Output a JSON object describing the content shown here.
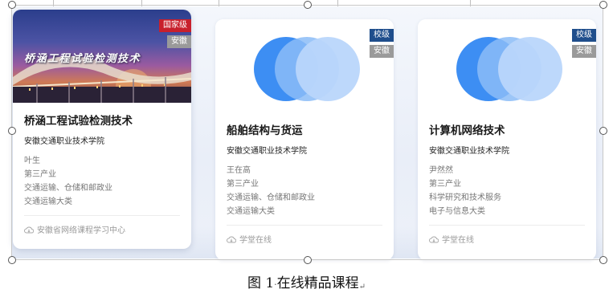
{
  "figure": {
    "caption_label": "图 1",
    "caption_sep": "·",
    "caption_text": "在线精品课程",
    "paragraph_mark": "↵"
  },
  "cards": [
    {
      "cover_type": "photo",
      "cover_title": "桥涵工程试验检测技术",
      "level_badge": "国家级",
      "level_color": "#c8202c",
      "region_badge": "安徽",
      "title": "桥涵工程试验检测技术",
      "school": "安徽交通职业技术学院",
      "teacher": "叶生",
      "industry": "第三产业",
      "sector": "交通运输、仓储和邮政业",
      "category": "交通运输大类",
      "platform": "安徽省网络课程学习中心"
    },
    {
      "cover_type": "circles",
      "level_badge": "校级",
      "level_color": "#1f4e8c",
      "region_badge": "安徽",
      "title": "船舶结构与货运",
      "school": "安徽交通职业技术学院",
      "teacher": "王在高",
      "industry": "第三产业",
      "sector": "交通运输、仓储和邮政业",
      "category": "交通运输大类",
      "platform": "学堂在线"
    },
    {
      "cover_type": "circles",
      "level_badge": "校级",
      "level_color": "#1f4e8c",
      "region_badge": "安徽",
      "title": "计算机网络技术",
      "school": "安徽交通职业技术学院",
      "teacher": "尹然然",
      "industry": "第三产业",
      "sector": "科学研究和技术服务",
      "category": "电子与信息大类",
      "platform": "学堂在线"
    }
  ]
}
